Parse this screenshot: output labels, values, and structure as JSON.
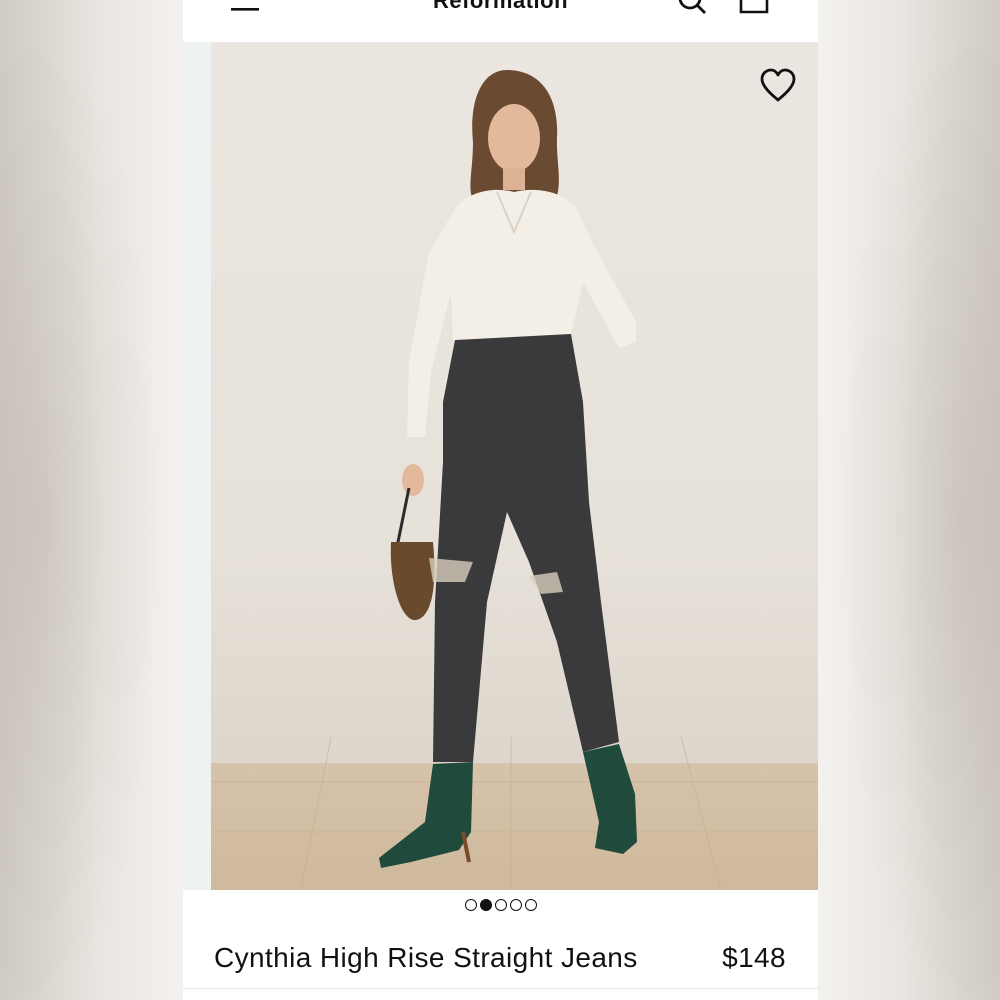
{
  "header": {
    "brand": "Reformation",
    "menu_icon": "hamburger-menu-icon",
    "search_icon": "search-icon",
    "bag_icon": "shopping-bag-icon"
  },
  "gallery": {
    "wishlist_icon": "heart-icon",
    "slide_count": 5,
    "active_slide": 2
  },
  "product": {
    "name": "Cynthia High Rise Straight Jeans",
    "price": "$148"
  },
  "colors": {
    "text": "#111111",
    "background": "#ffffff",
    "denim": "#3a3a3c",
    "boots": "#1f4a3c"
  }
}
